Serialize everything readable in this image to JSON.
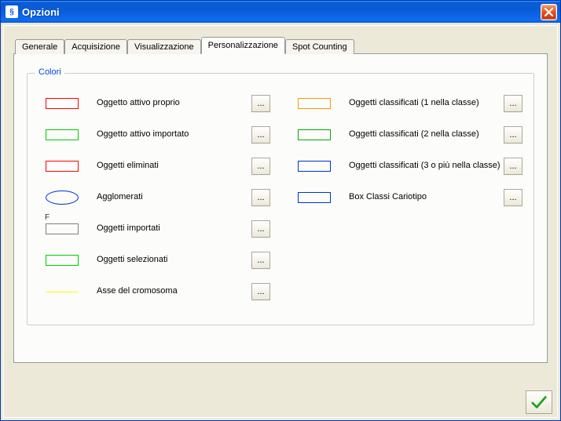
{
  "window": {
    "title": "Opzioni"
  },
  "tabs": {
    "items": [
      {
        "label": "Generale"
      },
      {
        "label": "Acquisizione"
      },
      {
        "label": "Visualizzazione"
      },
      {
        "label": "Personalizzazione"
      },
      {
        "label": "Spot Counting"
      }
    ],
    "active_index": 3
  },
  "group": {
    "legend": "Colori"
  },
  "left_items": [
    {
      "label": "Oggetto attivo proprio",
      "shape": "rect",
      "color": "#ff0000",
      "fmark": ""
    },
    {
      "label": "Oggetto attivo importato",
      "shape": "rect",
      "color": "#00cc00",
      "fmark": ""
    },
    {
      "label": "Oggetti eliminati",
      "shape": "rect",
      "color": "#ff0000",
      "fmark": ""
    },
    {
      "label": "Agglomerati",
      "shape": "ellipse",
      "color": "#0033cc",
      "fmark": ""
    },
    {
      "label": "Oggetti importati",
      "shape": "rect",
      "color": "#7f7f7f",
      "fmark": "F"
    },
    {
      "label": "Oggetti selezionati",
      "shape": "rect",
      "color": "#00cc00",
      "fmark": ""
    },
    {
      "label": "Asse del cromosoma",
      "shape": "line",
      "color": "#ffff00",
      "fmark": ""
    }
  ],
  "right_items": [
    {
      "label": "Oggetti classificati (1 nella classe)",
      "shape": "rect",
      "color": "#ff9900"
    },
    {
      "label": "Oggetti classificati (2 nella classe)",
      "shape": "rect",
      "color": "#00aa00"
    },
    {
      "label": "Oggetti classificati (3 o più nella classe)",
      "shape": "rect",
      "color": "#0033cc"
    },
    {
      "label": "Box Classi Cariotipo",
      "shape": "rect",
      "color": "#0033cc"
    }
  ],
  "buttons": {
    "ellipsis": "..."
  }
}
